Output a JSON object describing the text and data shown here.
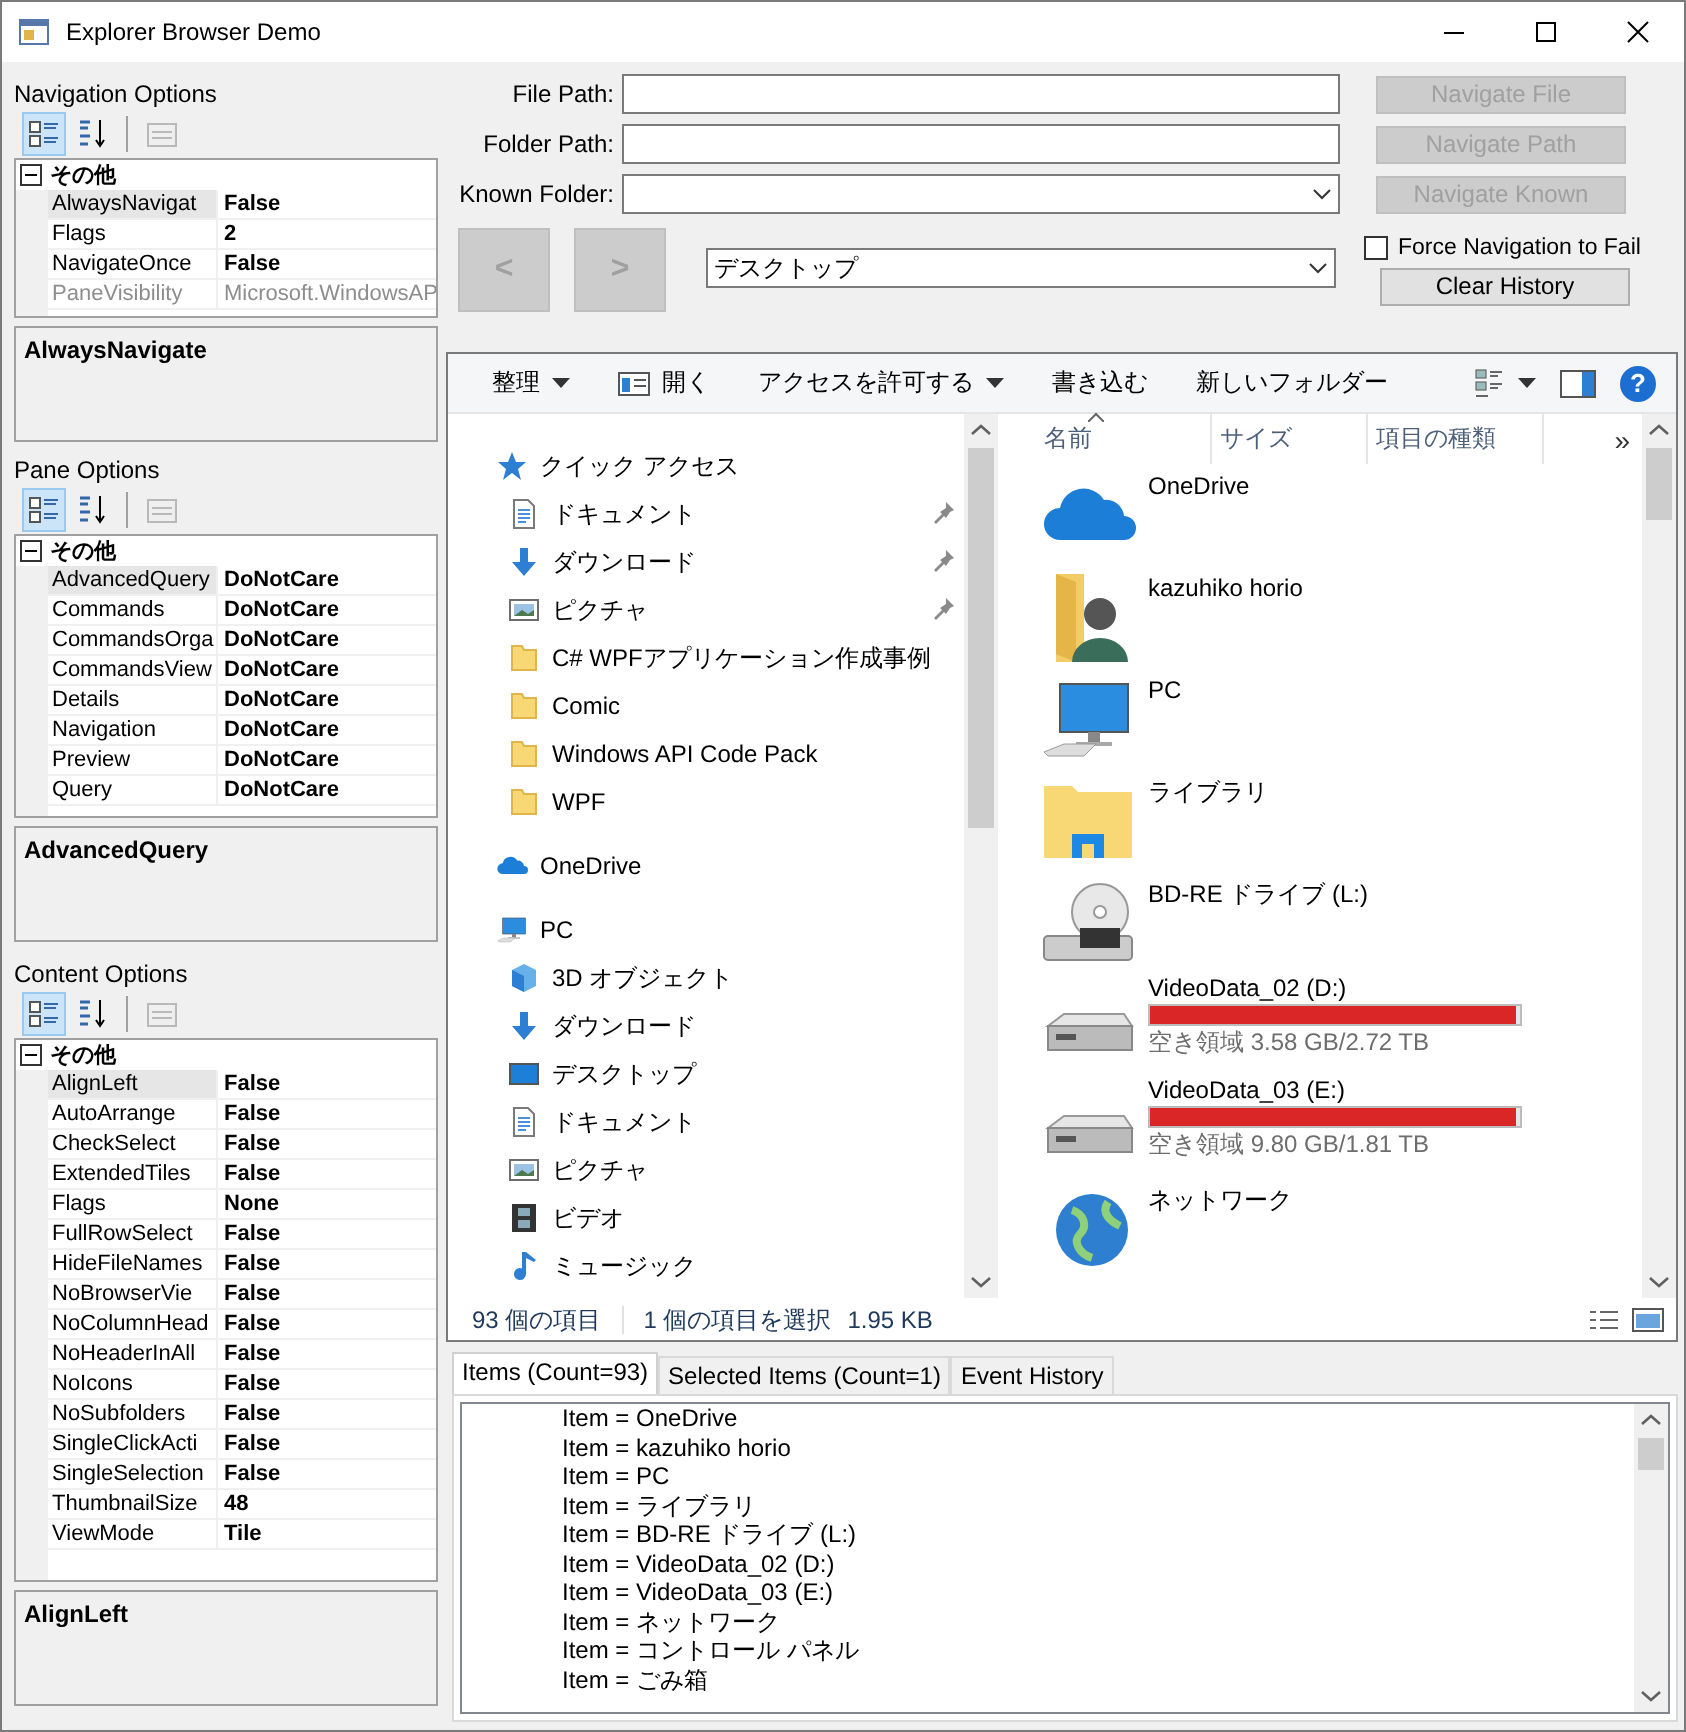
{
  "window": {
    "title": "Explorer Browser Demo"
  },
  "property_panels": [
    {
      "label": "Navigation Options",
      "toolbar": [
        {
          "kind": "categorized",
          "selected": true,
          "disabled": false
        },
        {
          "kind": "alphabetical",
          "selected": false,
          "disabled": false
        },
        {
          "kind": "pages",
          "selected": false,
          "disabled": true
        }
      ],
      "category": {
        "name": "その他",
        "expanded": true
      },
      "properties": [
        {
          "name": "AlwaysNavigat",
          "value": "False",
          "selected": true,
          "disabled": false
        },
        {
          "name": "Flags",
          "value": "2",
          "selected": false,
          "disabled": false
        },
        {
          "name": "NavigateOnce",
          "value": "False",
          "selected": false,
          "disabled": false
        },
        {
          "name": "PaneVisibility",
          "value": "Microsoft.WindowsAP",
          "selected": false,
          "disabled": true
        }
      ],
      "description": "AlwaysNavigate"
    },
    {
      "label": "Pane Options",
      "toolbar": [
        {
          "kind": "categorized",
          "selected": true,
          "disabled": false
        },
        {
          "kind": "alphabetical",
          "selected": false,
          "disabled": false
        },
        {
          "kind": "pages",
          "selected": false,
          "disabled": true
        }
      ],
      "category": {
        "name": "その他",
        "expanded": true
      },
      "properties": [
        {
          "name": "AdvancedQuery",
          "value": "DoNotCare",
          "selected": true,
          "disabled": false
        },
        {
          "name": "Commands",
          "value": "DoNotCare",
          "selected": false,
          "disabled": false
        },
        {
          "name": "CommandsOrga",
          "value": "DoNotCare",
          "selected": false,
          "disabled": false
        },
        {
          "name": "CommandsView",
          "value": "DoNotCare",
          "selected": false,
          "disabled": false
        },
        {
          "name": "Details",
          "value": "DoNotCare",
          "selected": false,
          "disabled": false
        },
        {
          "name": "Navigation",
          "value": "DoNotCare",
          "selected": false,
          "disabled": false
        },
        {
          "name": "Preview",
          "value": "DoNotCare",
          "selected": false,
          "disabled": false
        },
        {
          "name": "Query",
          "value": "DoNotCare",
          "selected": false,
          "disabled": false
        }
      ],
      "description": "AdvancedQuery"
    },
    {
      "label": "Content Options",
      "toolbar": [
        {
          "kind": "categorized",
          "selected": true,
          "disabled": false
        },
        {
          "kind": "alphabetical",
          "selected": false,
          "disabled": false
        },
        {
          "kind": "pages",
          "selected": false,
          "disabled": true
        }
      ],
      "category": {
        "name": "その他",
        "expanded": true
      },
      "properties": [
        {
          "name": "AlignLeft",
          "value": "False",
          "selected": true,
          "disabled": false
        },
        {
          "name": "AutoArrange",
          "value": "False",
          "selected": false,
          "disabled": false
        },
        {
          "name": "CheckSelect",
          "value": "False",
          "selected": false,
          "disabled": false
        },
        {
          "name": "ExtendedTiles",
          "value": "False",
          "selected": false,
          "disabled": false
        },
        {
          "name": "Flags",
          "value": "None",
          "selected": false,
          "disabled": false
        },
        {
          "name": "FullRowSelect",
          "value": "False",
          "selected": false,
          "disabled": false
        },
        {
          "name": "HideFileNames",
          "value": "False",
          "selected": false,
          "disabled": false
        },
        {
          "name": "NoBrowserVie",
          "value": "False",
          "selected": false,
          "disabled": false
        },
        {
          "name": "NoColumnHead",
          "value": "False",
          "selected": false,
          "disabled": false
        },
        {
          "name": "NoHeaderInAll",
          "value": "False",
          "selected": false,
          "disabled": false
        },
        {
          "name": "NoIcons",
          "value": "False",
          "selected": false,
          "disabled": false
        },
        {
          "name": "NoSubfolders",
          "value": "False",
          "selected": false,
          "disabled": false
        },
        {
          "name": "SingleClickActi",
          "value": "False",
          "selected": false,
          "disabled": false
        },
        {
          "name": "SingleSelection",
          "value": "False",
          "selected": false,
          "disabled": false
        },
        {
          "name": "ThumbnailSize",
          "value": "48",
          "selected": false,
          "disabled": false
        },
        {
          "name": "ViewMode",
          "value": "Tile",
          "selected": false,
          "disabled": false
        }
      ],
      "description": "AlignLeft"
    }
  ],
  "navigation": {
    "fields": [
      {
        "label": "File Path:",
        "kind": "text"
      },
      {
        "label": "Folder Path:",
        "kind": "text"
      },
      {
        "label": "Known Folder:",
        "kind": "combo"
      }
    ],
    "buttons": [
      {
        "label": "Navigate File",
        "disabled": true
      },
      {
        "label": "Navigate Path",
        "disabled": true
      },
      {
        "label": "Navigate Known",
        "disabled": true
      }
    ],
    "back": {
      "label": "<",
      "disabled": true
    },
    "forward": {
      "label": ">",
      "disabled": true
    },
    "location": {
      "value": "デスクトップ"
    },
    "force_fail": {
      "label": "Force Navigation to Fail",
      "checked": false
    },
    "clear_history": {
      "label": "Clear History",
      "disabled": false
    }
  },
  "explorer": {
    "toolbar": [
      {
        "label": "整理",
        "kind": "dropdown"
      },
      {
        "label": "開く",
        "kind": "icon"
      },
      {
        "label": "アクセスを許可する",
        "kind": "dropdown"
      },
      {
        "label": "書き込む",
        "kind": "plain"
      },
      {
        "label": "新しいフォルダー",
        "kind": "plain"
      }
    ],
    "help": "?",
    "tree": [
      {
        "label": "クイック アクセス",
        "kind": "star",
        "children": [
          {
            "label": "ドキュメント",
            "kind": "document",
            "pinned": true
          },
          {
            "label": "ダウンロード",
            "kind": "download",
            "pinned": true
          },
          {
            "label": "ピクチャ",
            "kind": "picture",
            "pinned": true
          },
          {
            "label": "C# WPFアプリケーション作成事例",
            "kind": "folder",
            "pinned": false
          },
          {
            "label": "Comic",
            "kind": "folder",
            "pinned": false
          },
          {
            "label": "Windows API Code Pack",
            "kind": "folder",
            "pinned": false
          },
          {
            "label": "WPF",
            "kind": "folder",
            "pinned": false
          }
        ]
      },
      {
        "label": "OneDrive",
        "kind": "cloud"
      },
      {
        "label": "PC",
        "kind": "pc",
        "children": [
          {
            "label": "3D オブジェクト",
            "kind": "cube"
          },
          {
            "label": "ダウンロード",
            "kind": "download"
          },
          {
            "label": "デスクトップ",
            "kind": "desktop"
          },
          {
            "label": "ドキュメント",
            "kind": "document"
          },
          {
            "label": "ピクチャ",
            "kind": "picture"
          },
          {
            "label": "ビデオ",
            "kind": "video"
          },
          {
            "label": "ミュージック",
            "kind": "music"
          }
        ]
      }
    ],
    "columns": [
      {
        "label": "名前",
        "sorted": true
      },
      {
        "label": "サイズ",
        "sorted": false
      },
      {
        "label": "項目の種類",
        "sorted": false
      }
    ],
    "more_columns": "»",
    "items": [
      {
        "name": "OneDrive",
        "kind": "cloud"
      },
      {
        "name": "kazuhiko horio",
        "kind": "user"
      },
      {
        "name": "PC",
        "kind": "pc"
      },
      {
        "name": "ライブラリ",
        "kind": "library"
      },
      {
        "name": "BD-RE ドライブ (L:)",
        "kind": "bd"
      },
      {
        "name": "VideoData_02 (D:)",
        "kind": "drive",
        "level": 0.99,
        "free": "空き領域 3.58 GB/2.72 TB"
      },
      {
        "name": "VideoData_03 (E:)",
        "kind": "drive",
        "level": 0.99,
        "free": "空き領域 9.80 GB/1.81 TB"
      },
      {
        "name": "ネットワーク",
        "kind": "network"
      }
    ],
    "status": [
      "93 個の項目",
      "1 個の項目を選択",
      "1.95 KB"
    ]
  },
  "log": {
    "tabs": [
      {
        "label": "Items (Count=93)",
        "selected": true
      },
      {
        "label": "Selected Items (Count=1)",
        "selected": false
      },
      {
        "label": "Event History",
        "selected": false
      }
    ],
    "lines": [
      "Item = OneDrive",
      "Item = kazuhiko horio",
      "Item = PC",
      "Item = ライブラリ",
      "Item = BD-RE ドライブ (L:)",
      "Item = VideoData_02 (D:)",
      "Item = VideoData_03 (E:)",
      "Item = ネットワーク",
      "Item = コントロール パネル",
      "Item = ごみ箱"
    ]
  }
}
